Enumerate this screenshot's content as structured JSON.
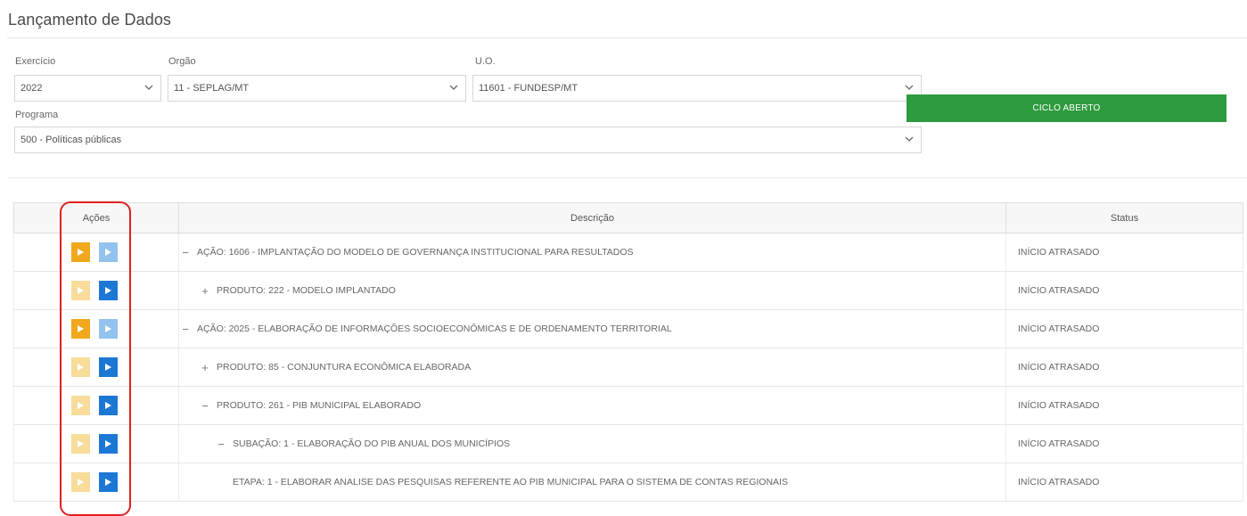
{
  "page": {
    "title": "Lançamento de Dados"
  },
  "filters": {
    "exercicio": {
      "label": "Exercício",
      "value": "2022"
    },
    "orgao": {
      "label": "Orgão",
      "value": "11 - SEPLAG/MT"
    },
    "uo": {
      "label": "U.O.",
      "value": "11601 - FUNDESP/MT"
    },
    "programa": {
      "label": "Programa",
      "value": "500 - Políticas públicas"
    }
  },
  "ciclo_button": {
    "label": "CICLO ABERTO",
    "color": "#2e9b3e"
  },
  "table": {
    "headers": {
      "acoes": "Ações",
      "descricao": "Descrição",
      "status": "Status"
    },
    "rows": [
      {
        "toggle": "−",
        "description": "AÇÃO: 1606 - IMPLANTAÇÃO DO MODELO DE GOVERNANÇA INSTITUCIONAL PARA RESULTADOS",
        "status": "INÍCIO ATRASADO",
        "level": 0
      },
      {
        "toggle": "+",
        "description": "PRODUTO: 222 - MODELO IMPLANTADO",
        "status": "INÍCIO ATRASADO",
        "level": 1
      },
      {
        "toggle": "−",
        "description": "AÇÃO: 2025 - ELABORAÇÃO DE INFORMAÇÕES SOCIOECONÔMICAS E DE ORDENAMENTO TERRITORIAL",
        "status": "INÍCIO ATRASADO",
        "level": 0
      },
      {
        "toggle": "+",
        "description": "PRODUTO: 85 - CONJUNTURA ECONÔMICA ELABORADA",
        "status": "INÍCIO ATRASADO",
        "level": 1
      },
      {
        "toggle": "−",
        "description": "PRODUTO: 261 - PIB MUNICIPAL ELABORADO",
        "status": "INÍCIO ATRASADO",
        "level": 1
      },
      {
        "toggle": "−",
        "description": "SUBAÇÃO: 1 - ELABORAÇÃO DO PIB ANUAL DOS MUNICÍPIOS",
        "status": "INÍCIO ATRASADO",
        "level": 2
      },
      {
        "toggle": "",
        "description": "ETAPA: 1 - ELABORAR ANALISE DAS PESQUISAS REFERENTE AO PIB MUNICIPAL PARA O SISTEMA DE CONTAS REGIONAIS",
        "status": "INÍCIO ATRASADO",
        "level": 3
      }
    ]
  },
  "actions": {
    "icon_primary": "play-icon",
    "icon_secondary": "document-play-icon",
    "colors": {
      "orange": "#f0a81c",
      "orange_faded": "#f7dc9a",
      "blue": "#1c78d4",
      "blue_faded": "#93c2ee"
    },
    "rows": [
      {
        "a1": "orange",
        "a2": "blue_faded"
      },
      {
        "a1": "orange_faded",
        "a2": "blue"
      },
      {
        "a1": "orange",
        "a2": "blue_faded"
      },
      {
        "a1": "orange_faded",
        "a2": "blue"
      },
      {
        "a1": "orange_faded",
        "a2": "blue"
      },
      {
        "a1": "orange_faded",
        "a2": "blue"
      },
      {
        "a1": "orange_faded",
        "a2": "blue"
      }
    ]
  },
  "annotation": {
    "highlight_color": "#e02020"
  }
}
